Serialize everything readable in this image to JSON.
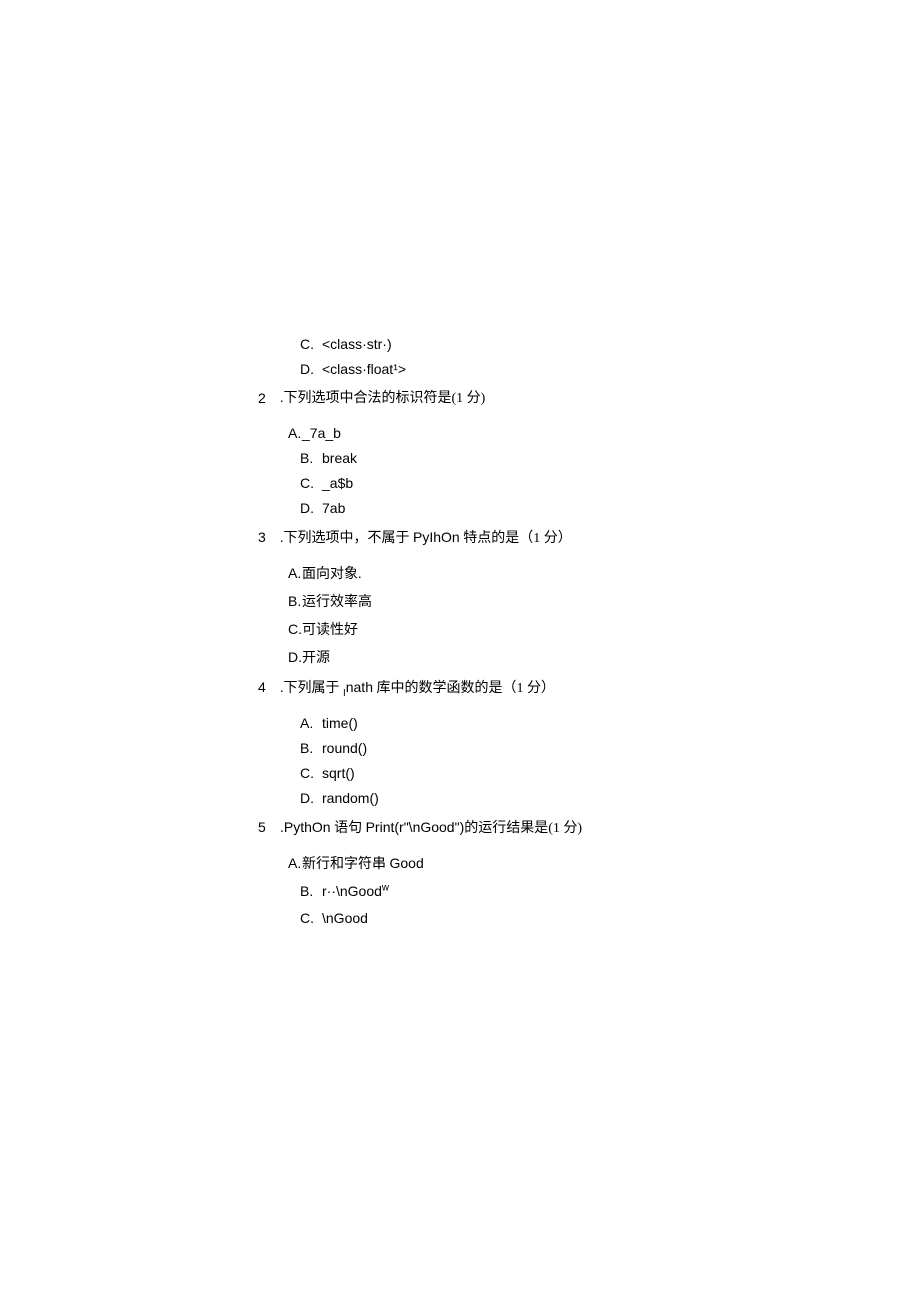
{
  "frag1": {
    "optC": {
      "letter": "C.",
      "text": "<class·str·)"
    },
    "optD": {
      "letter": "D.",
      "text": "<class·float¹>"
    }
  },
  "q2": {
    "num": "2",
    "body": ".下列选项中合法的标识符是(1 分)",
    "optA": {
      "letter": "A.",
      "text": "_7a_b"
    },
    "optB": {
      "letter": "B.",
      "text": "break"
    },
    "optC": {
      "letter": "C.",
      "text": "_a$b"
    },
    "optD": {
      "letter": "D.",
      "text": "7ab"
    }
  },
  "q3": {
    "num": "3",
    "body1": ".下列选项中，不属于 ",
    "body_sans": "PyIhOn",
    "body2": " 特点的是（1 分）",
    "optA": {
      "letter": "A.",
      "text": "面向对象."
    },
    "optB": {
      "letter": "B.",
      "text": "运行效率高"
    },
    "optC": {
      "letter": "C.",
      "text": "可读性好"
    },
    "optD": {
      "letter": "D.",
      "text": "开源"
    }
  },
  "q4": {
    "num": "4",
    "body1": ".下列属于 ",
    "body_sub": "I",
    "body_sans": "nath",
    "body2": " 库中的数学函数的是（1 分）",
    "optA": {
      "letter": "A.",
      "text": "time()"
    },
    "optB": {
      "letter": "B.",
      "text": "round()"
    },
    "optC": {
      "letter": "C.",
      "text": "sqrt()"
    },
    "optD": {
      "letter": "D.",
      "text": "random()"
    }
  },
  "q5": {
    "num": "5",
    "body1": ".PythOn",
    "body2": " 语句 ",
    "body3": "Print(r\"\\nGood\")",
    "body4": "的运行结果是(1 分)",
    "optA": {
      "letter": "A.",
      "text1": "新行和字符串 ",
      "text2": "Good"
    },
    "optB": {
      "letter": "B.",
      "text1": "r··\\nGood",
      "sup": "w"
    },
    "optC": {
      "letter": "C.",
      "text": "\\nGood"
    }
  }
}
